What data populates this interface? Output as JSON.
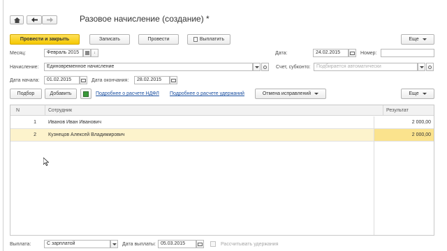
{
  "window": {
    "title": "Разовое начисление (создание) *",
    "nav": {
      "home_icon": "home-icon",
      "back_icon": "arrow-left-icon",
      "forward_icon": "arrow-right-icon"
    }
  },
  "toolbar": {
    "post_close": "Провести и закрыть",
    "save": "Записать",
    "post": "Провести",
    "pay": "Выплатить",
    "more": "Еще"
  },
  "form": {
    "month_label": "Месяц:",
    "month_value": "Февраль 2015",
    "date_label": "Дата:",
    "date_value": "24.02.2015",
    "number_label": "Номер:",
    "number_value": "",
    "accrual_label": "Начисление:",
    "accrual_value": "Единовременное начисление",
    "account_label": "Счет, субконто:",
    "account_placeholder": "Подбирается автоматически",
    "start_label": "Дата начала:",
    "start_value": "01.02.2015",
    "end_label": "Дата окончания:",
    "end_value": "28.02.2015"
  },
  "table_toolbar": {
    "select": "Подбор",
    "add": "Добавить",
    "ndfl_link": "Подробнее о расчете НДФЛ",
    "deductions_link": "Подробнее о расчете удержаний",
    "cancel_corrections": "Отмена исправлений",
    "more": "Еще"
  },
  "table": {
    "columns": [
      "N",
      "Сотрудник",
      "Результат"
    ],
    "rows": [
      {
        "n": "1",
        "employee": "Иванов Иван Иванович",
        "result": "2 000,00"
      },
      {
        "n": "2",
        "employee": "Кузнецов Алексей Владимирович",
        "result": "2 000,00"
      }
    ]
  },
  "footer": {
    "payout_label": "Выплата:",
    "payout_value": "С зарплатой",
    "payout_date_label": "Дата выплаты:",
    "payout_date_value": "05.03.2015",
    "calc_deductions": "Рассчитывать удержания"
  },
  "colors": {
    "primary": "#f5c800",
    "selected_row": "#fdf3cc",
    "selected_cell": "#fbe38d",
    "link": "#1a4fa0"
  }
}
